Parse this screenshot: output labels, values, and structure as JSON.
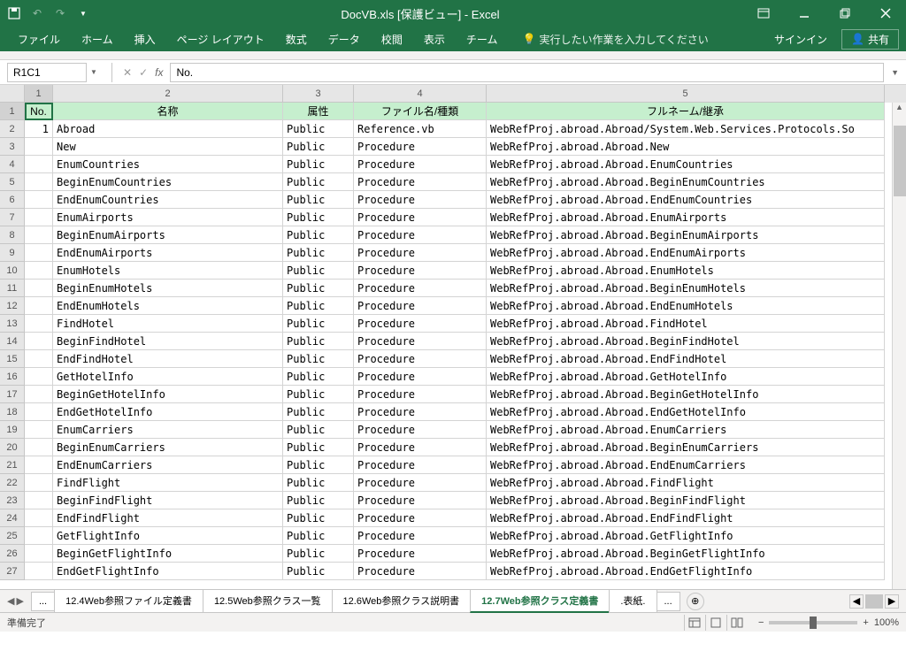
{
  "title": "DocVB.xls [保護ビュー] - Excel",
  "qat": {
    "save": "save-icon",
    "undo": "undo-icon",
    "redo": "redo-icon"
  },
  "win": {
    "ribbon_opts": "ribbon-display-options",
    "min": "minimize",
    "max": "restore",
    "close": "close"
  },
  "ribbon": {
    "tabs": [
      "ファイル",
      "ホーム",
      "挿入",
      "ページ レイアウト",
      "数式",
      "データ",
      "校閲",
      "表示",
      "チーム"
    ],
    "tellme": "実行したい作業を入力してください",
    "signin": "サインイン",
    "share": "共有"
  },
  "namebox": "R1C1",
  "formula": "No.",
  "col_numbers": [
    "1",
    "2",
    "3",
    "4",
    "5"
  ],
  "row_numbers": [
    "1",
    "2",
    "3",
    "4",
    "5",
    "6",
    "7",
    "8",
    "9",
    "10",
    "11",
    "12",
    "13",
    "14",
    "15",
    "16",
    "17",
    "18",
    "19",
    "20",
    "21",
    "22",
    "23",
    "24",
    "25",
    "26",
    "27"
  ],
  "headers": [
    "No.",
    "名称",
    "属性",
    "ファイル名/種類",
    "フルネーム/継承"
  ],
  "rows": [
    {
      "no": "1",
      "name": "Abroad",
      "attr": "Public",
      "file": "Reference.vb",
      "full": "WebRefProj.abroad.Abroad/System.Web.Services.Protocols.So"
    },
    {
      "no": "",
      "name": "New",
      "attr": "Public",
      "file": "Procedure",
      "full": "WebRefProj.abroad.Abroad.New"
    },
    {
      "no": "",
      "name": "EnumCountries",
      "attr": "Public",
      "file": "Procedure",
      "full": "WebRefProj.abroad.Abroad.EnumCountries"
    },
    {
      "no": "",
      "name": "BeginEnumCountries",
      "attr": "Public",
      "file": "Procedure",
      "full": "WebRefProj.abroad.Abroad.BeginEnumCountries"
    },
    {
      "no": "",
      "name": "EndEnumCountries",
      "attr": "Public",
      "file": "Procedure",
      "full": "WebRefProj.abroad.Abroad.EndEnumCountries"
    },
    {
      "no": "",
      "name": "EnumAirports",
      "attr": "Public",
      "file": "Procedure",
      "full": "WebRefProj.abroad.Abroad.EnumAirports"
    },
    {
      "no": "",
      "name": "BeginEnumAirports",
      "attr": "Public",
      "file": "Procedure",
      "full": "WebRefProj.abroad.Abroad.BeginEnumAirports"
    },
    {
      "no": "",
      "name": "EndEnumAirports",
      "attr": "Public",
      "file": "Procedure",
      "full": "WebRefProj.abroad.Abroad.EndEnumAirports"
    },
    {
      "no": "",
      "name": "EnumHotels",
      "attr": "Public",
      "file": "Procedure",
      "full": "WebRefProj.abroad.Abroad.EnumHotels"
    },
    {
      "no": "",
      "name": "BeginEnumHotels",
      "attr": "Public",
      "file": "Procedure",
      "full": "WebRefProj.abroad.Abroad.BeginEnumHotels"
    },
    {
      "no": "",
      "name": "EndEnumHotels",
      "attr": "Public",
      "file": "Procedure",
      "full": "WebRefProj.abroad.Abroad.EndEnumHotels"
    },
    {
      "no": "",
      "name": "FindHotel",
      "attr": "Public",
      "file": "Procedure",
      "full": "WebRefProj.abroad.Abroad.FindHotel"
    },
    {
      "no": "",
      "name": "BeginFindHotel",
      "attr": "Public",
      "file": "Procedure",
      "full": "WebRefProj.abroad.Abroad.BeginFindHotel"
    },
    {
      "no": "",
      "name": "EndFindHotel",
      "attr": "Public",
      "file": "Procedure",
      "full": "WebRefProj.abroad.Abroad.EndFindHotel"
    },
    {
      "no": "",
      "name": "GetHotelInfo",
      "attr": "Public",
      "file": "Procedure",
      "full": "WebRefProj.abroad.Abroad.GetHotelInfo"
    },
    {
      "no": "",
      "name": "BeginGetHotelInfo",
      "attr": "Public",
      "file": "Procedure",
      "full": "WebRefProj.abroad.Abroad.BeginGetHotelInfo"
    },
    {
      "no": "",
      "name": "EndGetHotelInfo",
      "attr": "Public",
      "file": "Procedure",
      "full": "WebRefProj.abroad.Abroad.EndGetHotelInfo"
    },
    {
      "no": "",
      "name": "EnumCarriers",
      "attr": "Public",
      "file": "Procedure",
      "full": "WebRefProj.abroad.Abroad.EnumCarriers"
    },
    {
      "no": "",
      "name": "BeginEnumCarriers",
      "attr": "Public",
      "file": "Procedure",
      "full": "WebRefProj.abroad.Abroad.BeginEnumCarriers"
    },
    {
      "no": "",
      "name": "EndEnumCarriers",
      "attr": "Public",
      "file": "Procedure",
      "full": "WebRefProj.abroad.Abroad.EndEnumCarriers"
    },
    {
      "no": "",
      "name": "FindFlight",
      "attr": "Public",
      "file": "Procedure",
      "full": "WebRefProj.abroad.Abroad.FindFlight"
    },
    {
      "no": "",
      "name": "BeginFindFlight",
      "attr": "Public",
      "file": "Procedure",
      "full": "WebRefProj.abroad.Abroad.BeginFindFlight"
    },
    {
      "no": "",
      "name": "EndFindFlight",
      "attr": "Public",
      "file": "Procedure",
      "full": "WebRefProj.abroad.Abroad.EndFindFlight"
    },
    {
      "no": "",
      "name": "GetFlightInfo",
      "attr": "Public",
      "file": "Procedure",
      "full": "WebRefProj.abroad.Abroad.GetFlightInfo"
    },
    {
      "no": "",
      "name": "BeginGetFlightInfo",
      "attr": "Public",
      "file": "Procedure",
      "full": "WebRefProj.abroad.Abroad.BeginGetFlightInfo"
    },
    {
      "no": "",
      "name": "EndGetFlightInfo",
      "attr": "Public",
      "file": "Procedure",
      "full": "WebRefProj.abroad.Abroad.EndGetFlightInfo"
    }
  ],
  "sheets": {
    "left_dots": "...",
    "tabs": [
      "12.4Web参照ファイル定義書",
      "12.5Web参照クラス一覧",
      "12.6Web参照クラス説明書",
      "12.7Web参照クラス定義書",
      ".表紙."
    ],
    "active": "12.7Web参照クラス定義書",
    "right_dots": "..."
  },
  "status": "準備完了",
  "zoom": "100%"
}
